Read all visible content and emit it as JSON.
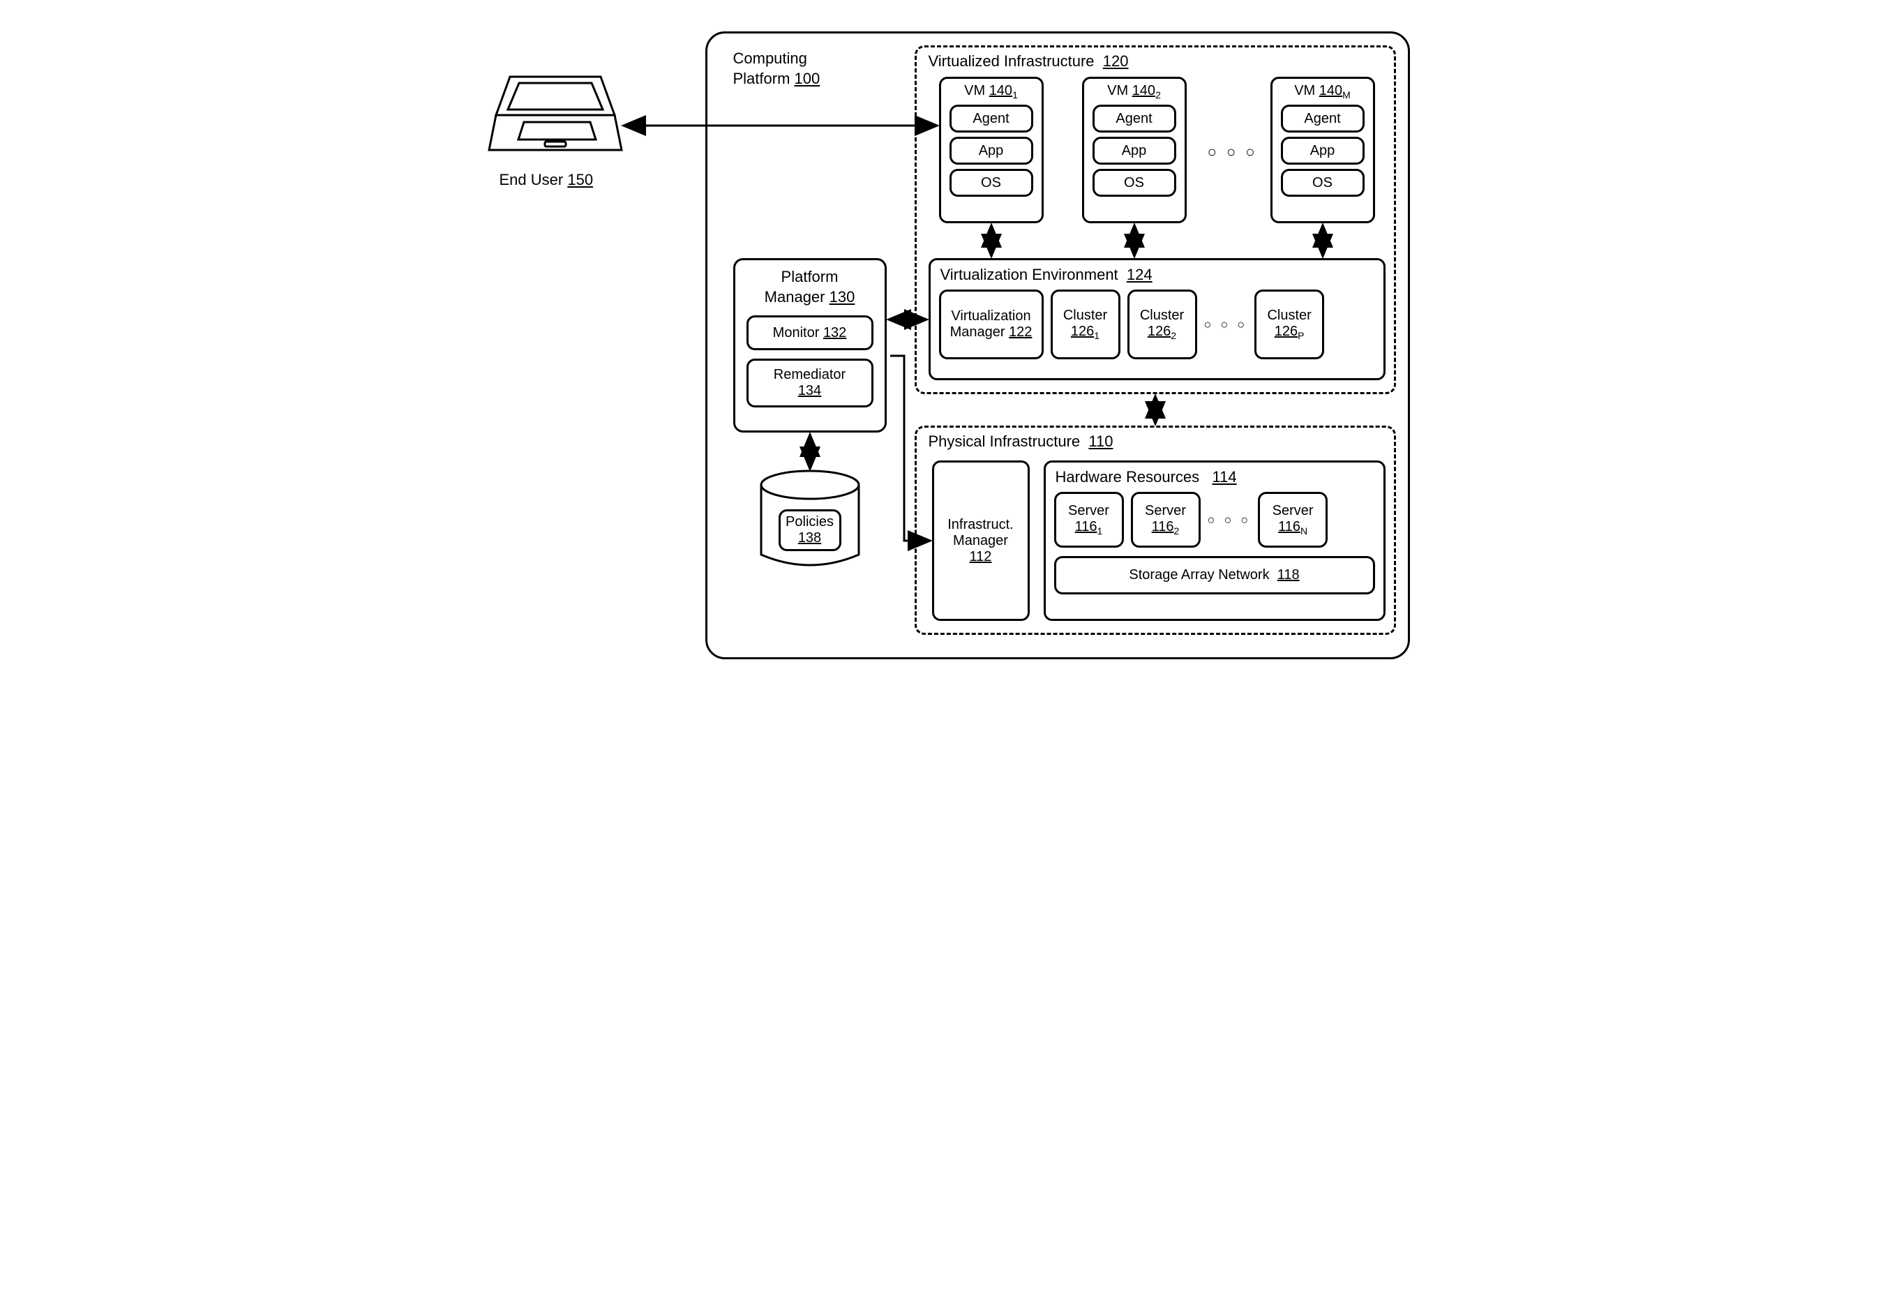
{
  "endUser": {
    "label": "End User",
    "ref": "150"
  },
  "platform": {
    "label1": "Computing",
    "label2": "Platform",
    "ref": "100"
  },
  "virtualized": {
    "label": "Virtualized Infrastructure",
    "ref": "120"
  },
  "vms": {
    "vm1": {
      "label": "VM",
      "ref": "140",
      "sub": "1",
      "agent": "Agent",
      "app": "App",
      "os": "OS"
    },
    "vm2": {
      "label": "VM",
      "ref": "140",
      "sub": "2",
      "agent": "Agent",
      "app": "App",
      "os": "OS"
    },
    "vmM": {
      "label": "VM",
      "ref": "140",
      "sub": "M",
      "agent": "Agent",
      "app": "App",
      "os": "OS"
    }
  },
  "virtEnv": {
    "label": "Virtualization Environment",
    "ref": "124",
    "vmgr": {
      "label1": "Virtualization",
      "label2": "Manager",
      "ref": "122"
    },
    "cluster1": {
      "label": "Cluster",
      "ref": "126",
      "sub": "1"
    },
    "cluster2": {
      "label": "Cluster",
      "ref": "126",
      "sub": "2"
    },
    "clusterP": {
      "label": "Cluster",
      "ref": "126",
      "sub": "P"
    }
  },
  "platformMgr": {
    "label1": "Platform",
    "label2": "Manager",
    "ref": "130",
    "monitor": {
      "label": "Monitor",
      "ref": "132"
    },
    "remediator": {
      "label": "Remediator",
      "ref": "134"
    }
  },
  "policies": {
    "label": "Policies",
    "ref": "138"
  },
  "physical": {
    "label": "Physical Infrastructure",
    "ref": "110",
    "imgr": {
      "label1": "Infrastruct.",
      "label2": "Manager",
      "ref": "112"
    },
    "hw": {
      "label": "Hardware Resources",
      "ref": "114"
    },
    "server1": {
      "label": "Server",
      "ref": "116",
      "sub": "1"
    },
    "server2": {
      "label": "Server",
      "ref": "116",
      "sub": "2"
    },
    "serverN": {
      "label": "Server",
      "ref": "116",
      "sub": "N"
    },
    "san": {
      "label": "Storage Array Network",
      "ref": "118"
    }
  },
  "dots": "○ ○ ○"
}
